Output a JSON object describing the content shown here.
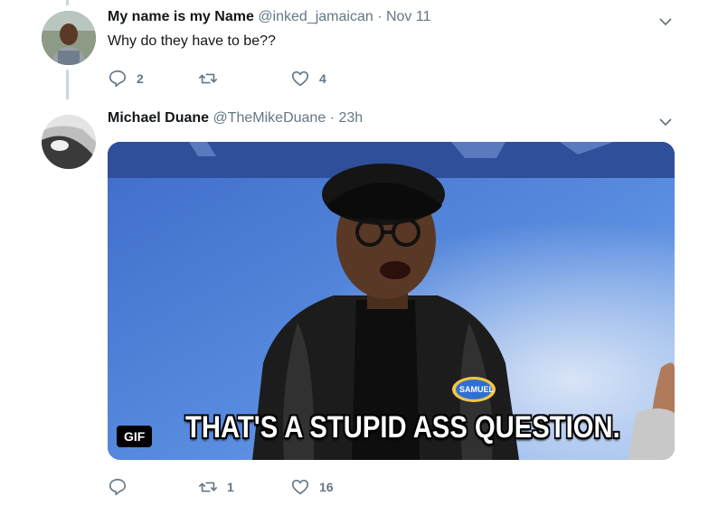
{
  "tweets": [
    {
      "name": "My name is my Name",
      "handle": "@inked_jamaican",
      "separator": "·",
      "time": "Nov 11",
      "text": "Why do they have to be??",
      "reply_count": "2",
      "retweet_count": "",
      "like_count": "4"
    },
    {
      "name": "Michael Duane",
      "handle": "@TheMikeDuane",
      "separator": "·",
      "time": "23h",
      "media": {
        "badge": "GIF",
        "caption": "THAT'S A STUPID ASS QUESTION.",
        "nametag": "SAMUEL"
      },
      "reply_count": "",
      "retweet_count": "1",
      "like_count": "16"
    }
  ],
  "icons": [
    "reply-icon",
    "retweet-icon",
    "like-icon",
    "chevron-down-icon"
  ],
  "colors": {
    "text": "#14171a",
    "muted": "#657786",
    "thread_line": "#ccd6dd"
  }
}
